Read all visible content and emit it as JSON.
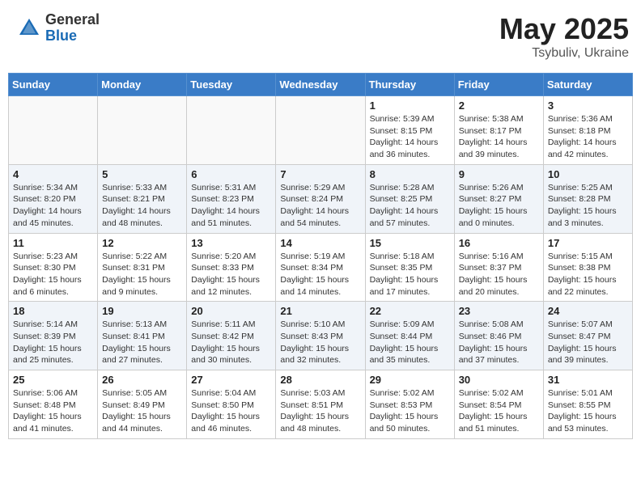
{
  "header": {
    "logo_general": "General",
    "logo_blue": "Blue",
    "title": "May 2025",
    "location": "Tsybuliv, Ukraine"
  },
  "weekdays": [
    "Sunday",
    "Monday",
    "Tuesday",
    "Wednesday",
    "Thursday",
    "Friday",
    "Saturday"
  ],
  "weeks": [
    [
      {
        "day": "",
        "info": ""
      },
      {
        "day": "",
        "info": ""
      },
      {
        "day": "",
        "info": ""
      },
      {
        "day": "",
        "info": ""
      },
      {
        "day": "1",
        "info": "Sunrise: 5:39 AM\nSunset: 8:15 PM\nDaylight: 14 hours\nand 36 minutes."
      },
      {
        "day": "2",
        "info": "Sunrise: 5:38 AM\nSunset: 8:17 PM\nDaylight: 14 hours\nand 39 minutes."
      },
      {
        "day": "3",
        "info": "Sunrise: 5:36 AM\nSunset: 8:18 PM\nDaylight: 14 hours\nand 42 minutes."
      }
    ],
    [
      {
        "day": "4",
        "info": "Sunrise: 5:34 AM\nSunset: 8:20 PM\nDaylight: 14 hours\nand 45 minutes."
      },
      {
        "day": "5",
        "info": "Sunrise: 5:33 AM\nSunset: 8:21 PM\nDaylight: 14 hours\nand 48 minutes."
      },
      {
        "day": "6",
        "info": "Sunrise: 5:31 AM\nSunset: 8:23 PM\nDaylight: 14 hours\nand 51 minutes."
      },
      {
        "day": "7",
        "info": "Sunrise: 5:29 AM\nSunset: 8:24 PM\nDaylight: 14 hours\nand 54 minutes."
      },
      {
        "day": "8",
        "info": "Sunrise: 5:28 AM\nSunset: 8:25 PM\nDaylight: 14 hours\nand 57 minutes."
      },
      {
        "day": "9",
        "info": "Sunrise: 5:26 AM\nSunset: 8:27 PM\nDaylight: 15 hours\nand 0 minutes."
      },
      {
        "day": "10",
        "info": "Sunrise: 5:25 AM\nSunset: 8:28 PM\nDaylight: 15 hours\nand 3 minutes."
      }
    ],
    [
      {
        "day": "11",
        "info": "Sunrise: 5:23 AM\nSunset: 8:30 PM\nDaylight: 15 hours\nand 6 minutes."
      },
      {
        "day": "12",
        "info": "Sunrise: 5:22 AM\nSunset: 8:31 PM\nDaylight: 15 hours\nand 9 minutes."
      },
      {
        "day": "13",
        "info": "Sunrise: 5:20 AM\nSunset: 8:33 PM\nDaylight: 15 hours\nand 12 minutes."
      },
      {
        "day": "14",
        "info": "Sunrise: 5:19 AM\nSunset: 8:34 PM\nDaylight: 15 hours\nand 14 minutes."
      },
      {
        "day": "15",
        "info": "Sunrise: 5:18 AM\nSunset: 8:35 PM\nDaylight: 15 hours\nand 17 minutes."
      },
      {
        "day": "16",
        "info": "Sunrise: 5:16 AM\nSunset: 8:37 PM\nDaylight: 15 hours\nand 20 minutes."
      },
      {
        "day": "17",
        "info": "Sunrise: 5:15 AM\nSunset: 8:38 PM\nDaylight: 15 hours\nand 22 minutes."
      }
    ],
    [
      {
        "day": "18",
        "info": "Sunrise: 5:14 AM\nSunset: 8:39 PM\nDaylight: 15 hours\nand 25 minutes."
      },
      {
        "day": "19",
        "info": "Sunrise: 5:13 AM\nSunset: 8:41 PM\nDaylight: 15 hours\nand 27 minutes."
      },
      {
        "day": "20",
        "info": "Sunrise: 5:11 AM\nSunset: 8:42 PM\nDaylight: 15 hours\nand 30 minutes."
      },
      {
        "day": "21",
        "info": "Sunrise: 5:10 AM\nSunset: 8:43 PM\nDaylight: 15 hours\nand 32 minutes."
      },
      {
        "day": "22",
        "info": "Sunrise: 5:09 AM\nSunset: 8:44 PM\nDaylight: 15 hours\nand 35 minutes."
      },
      {
        "day": "23",
        "info": "Sunrise: 5:08 AM\nSunset: 8:46 PM\nDaylight: 15 hours\nand 37 minutes."
      },
      {
        "day": "24",
        "info": "Sunrise: 5:07 AM\nSunset: 8:47 PM\nDaylight: 15 hours\nand 39 minutes."
      }
    ],
    [
      {
        "day": "25",
        "info": "Sunrise: 5:06 AM\nSunset: 8:48 PM\nDaylight: 15 hours\nand 41 minutes."
      },
      {
        "day": "26",
        "info": "Sunrise: 5:05 AM\nSunset: 8:49 PM\nDaylight: 15 hours\nand 44 minutes."
      },
      {
        "day": "27",
        "info": "Sunrise: 5:04 AM\nSunset: 8:50 PM\nDaylight: 15 hours\nand 46 minutes."
      },
      {
        "day": "28",
        "info": "Sunrise: 5:03 AM\nSunset: 8:51 PM\nDaylight: 15 hours\nand 48 minutes."
      },
      {
        "day": "29",
        "info": "Sunrise: 5:02 AM\nSunset: 8:53 PM\nDaylight: 15 hours\nand 50 minutes."
      },
      {
        "day": "30",
        "info": "Sunrise: 5:02 AM\nSunset: 8:54 PM\nDaylight: 15 hours\nand 51 minutes."
      },
      {
        "day": "31",
        "info": "Sunrise: 5:01 AM\nSunset: 8:55 PM\nDaylight: 15 hours\nand 53 minutes."
      }
    ]
  ]
}
